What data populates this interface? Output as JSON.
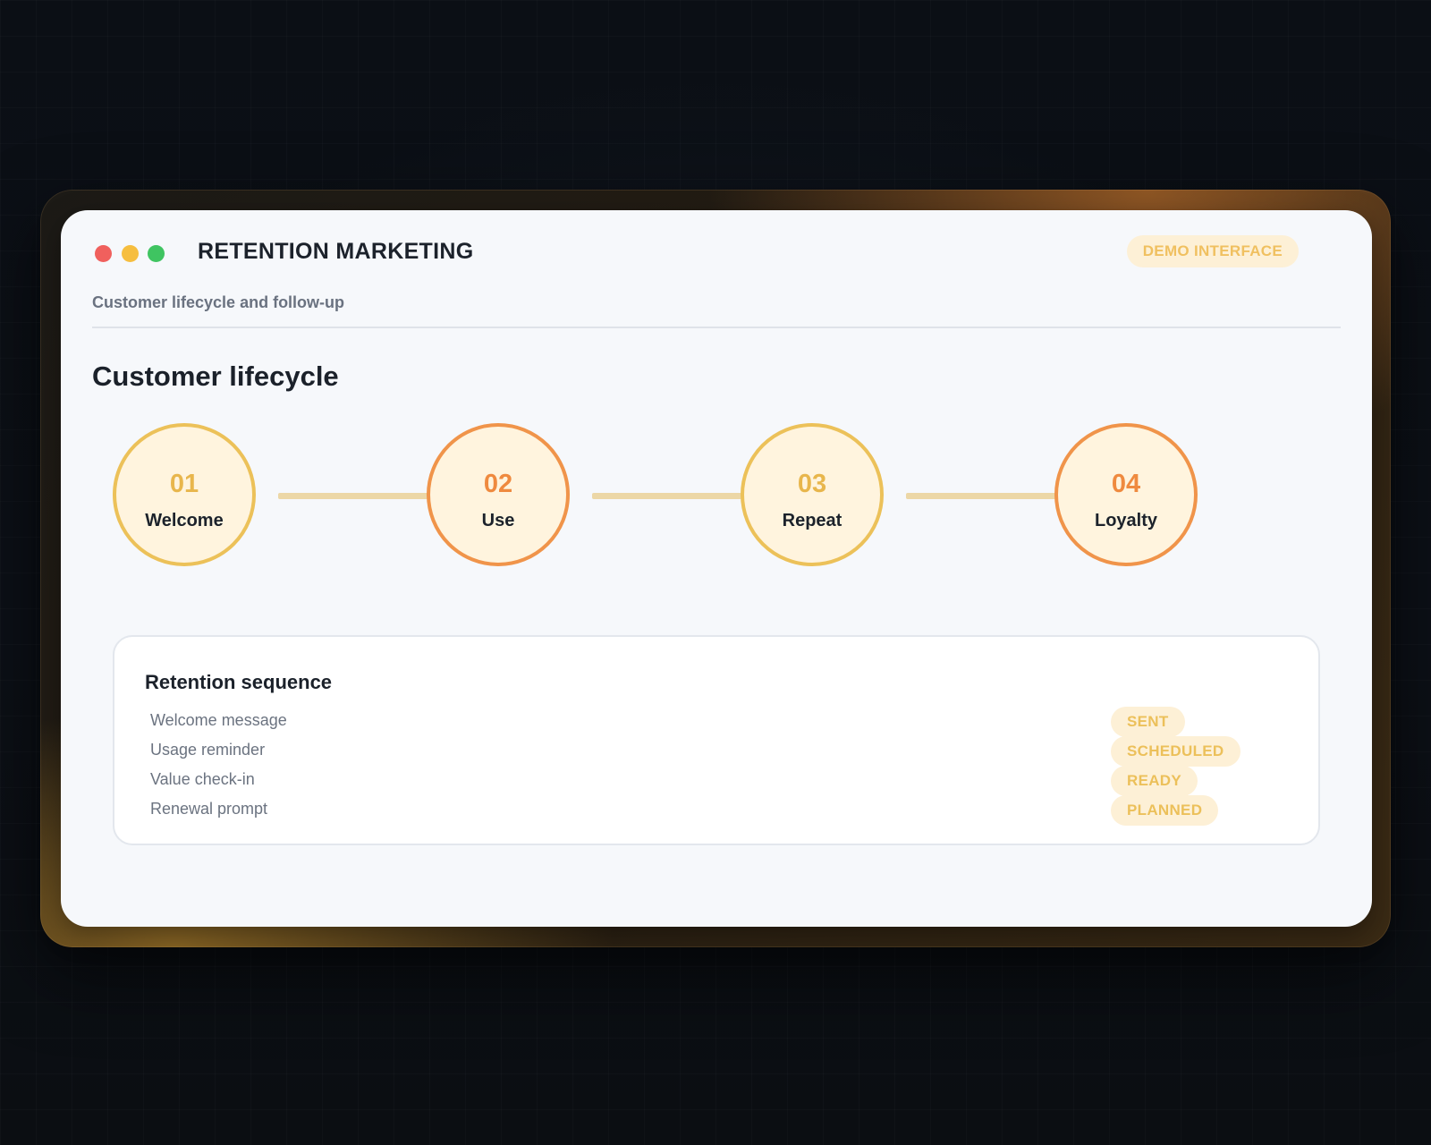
{
  "app": {
    "title": "RETENTION MARKETING",
    "badge": "DEMO INTERFACE",
    "subtitle": "Customer lifecycle and follow-up"
  },
  "window_controls": [
    "close",
    "minimize",
    "maximize"
  ],
  "lifecycle": {
    "title": "Customer lifecycle",
    "stages": [
      {
        "number": "01",
        "label": "Welcome",
        "accent": "#ecc159"
      },
      {
        "number": "02",
        "label": "Use",
        "accent": "#f0944a"
      },
      {
        "number": "03",
        "label": "Repeat",
        "accent": "#ecc159"
      },
      {
        "number": "04",
        "label": "Loyalty",
        "accent": "#f0944a"
      }
    ]
  },
  "sequence": {
    "title": "Retention sequence",
    "items": [
      {
        "name": "Welcome message",
        "status": "SENT"
      },
      {
        "name": "Usage reminder",
        "status": "SCHEDULED"
      },
      {
        "name": "Value check-in",
        "status": "READY"
      },
      {
        "name": "Renewal prompt",
        "status": "PLANNED"
      }
    ]
  },
  "colors": {
    "status_badge_bg": "#fdf0d6",
    "status_badge_text": "#ecc05a",
    "accent_yellow": "#ecc159",
    "accent_orange": "#f0944a"
  }
}
